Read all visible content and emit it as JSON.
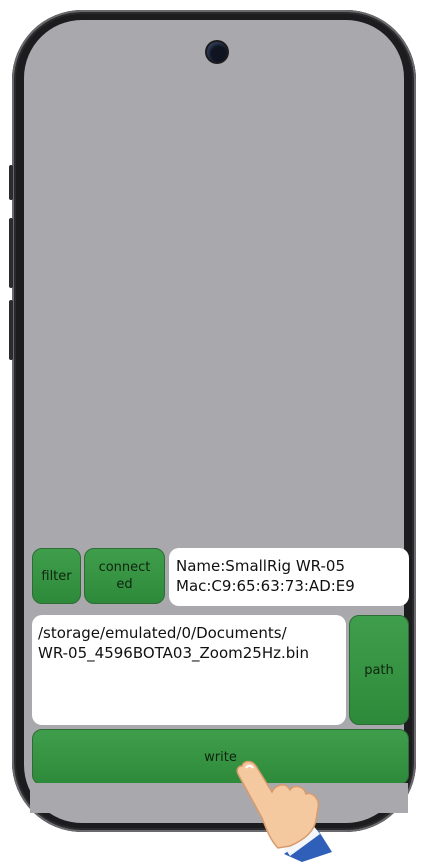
{
  "buttons": {
    "filter": "filter",
    "connected": "connect ed",
    "path": "path",
    "write": "write"
  },
  "device": {
    "name": "Name:SmallRig WR-05",
    "mac": "Mac:C9:65:63:73:AD:E9"
  },
  "file_path": "/storage/emulated/0/Documents/ WR-05_4596BOTA03_Zoom25Hz.bin",
  "icons": {
    "camera": "front-camera-icon",
    "hand": "pointing-hand-icon"
  },
  "colors": {
    "button_green": "#3a9948",
    "screen_gray": "#a9a9ad",
    "frame": "#1c1c1e"
  }
}
